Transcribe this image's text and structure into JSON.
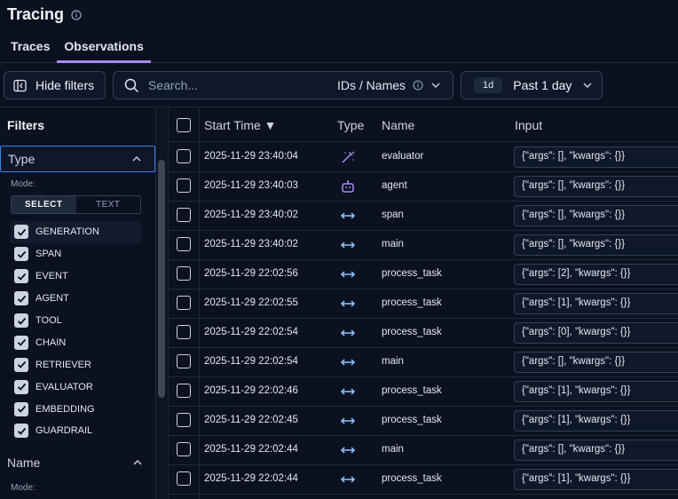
{
  "header": {
    "title": "Tracing",
    "tabs": [
      {
        "label": "Traces",
        "active": false
      },
      {
        "label": "Observations",
        "active": true
      }
    ]
  },
  "toolbar": {
    "hide_filters_label": "Hide filters",
    "search_placeholder": "Search...",
    "search_scope": "IDs / Names",
    "time_badge": "1d",
    "time_label": "Past 1 day"
  },
  "sidebar": {
    "heading": "Filters",
    "type_section": {
      "label": "Type",
      "mode_label": "Mode:",
      "mode_options": [
        "SELECT",
        "TEXT"
      ],
      "items": [
        "GENERATION",
        "SPAN",
        "EVENT",
        "AGENT",
        "TOOL",
        "CHAIN",
        "RETRIEVER",
        "EVALUATOR",
        "EMBEDDING",
        "GUARDRAIL"
      ]
    },
    "name_section": {
      "label": "Name",
      "mode_label": "Mode:"
    }
  },
  "table": {
    "columns": {
      "start_time": "Start Time ▼",
      "type": "Type",
      "name": "Name",
      "input": "Input"
    },
    "rows": [
      {
        "start_time": "2025-11-29 23:40:04",
        "type_icon": "evaluator-icon",
        "name": "evaluator",
        "input": "{\"args\": [], \"kwargs\": {}}"
      },
      {
        "start_time": "2025-11-29 23:40:03",
        "type_icon": "agent-icon",
        "name": "agent",
        "input": "{\"args\": [], \"kwargs\": {}}"
      },
      {
        "start_time": "2025-11-29 23:40:02",
        "type_icon": "span-icon",
        "name": "span",
        "input": "{\"args\": [], \"kwargs\": {}}"
      },
      {
        "start_time": "2025-11-29 23:40:02",
        "type_icon": "span-icon",
        "name": "main",
        "input": "{\"args\": [], \"kwargs\": {}}"
      },
      {
        "start_time": "2025-11-29 22:02:56",
        "type_icon": "span-icon",
        "name": "process_task",
        "input": "{\"args\": [2], \"kwargs\": {}}"
      },
      {
        "start_time": "2025-11-29 22:02:55",
        "type_icon": "span-icon",
        "name": "process_task",
        "input": "{\"args\": [1], \"kwargs\": {}}"
      },
      {
        "start_time": "2025-11-29 22:02:54",
        "type_icon": "span-icon",
        "name": "process_task",
        "input": "{\"args\": [0], \"kwargs\": {}}"
      },
      {
        "start_time": "2025-11-29 22:02:54",
        "type_icon": "span-icon",
        "name": "main",
        "input": "{\"args\": [], \"kwargs\": {}}"
      },
      {
        "start_time": "2025-11-29 22:02:46",
        "type_icon": "span-icon",
        "name": "process_task",
        "input": "{\"args\": [1], \"kwargs\": {}}"
      },
      {
        "start_time": "2025-11-29 22:02:45",
        "type_icon": "span-icon",
        "name": "process_task",
        "input": "{\"args\": [1], \"kwargs\": {}}"
      },
      {
        "start_time": "2025-11-29 22:02:44",
        "type_icon": "span-icon",
        "name": "main",
        "input": "{\"args\": [], \"kwargs\": {}}"
      },
      {
        "start_time": "2025-11-29 22:02:44",
        "type_icon": "span-icon",
        "name": "process_task",
        "input": "{\"args\": [1], \"kwargs\": {}}"
      }
    ]
  },
  "colors": {
    "background": "#0b1120",
    "accent": "#a78bfa",
    "span_icon": "#93c5fd",
    "border": "#1e293b"
  }
}
